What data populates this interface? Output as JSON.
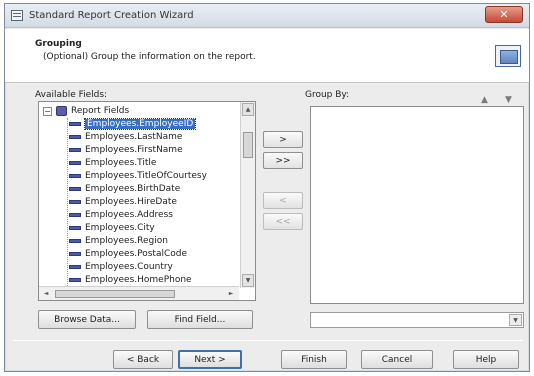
{
  "window": {
    "title": "Standard Report Creation Wizard",
    "close_glyph": "✕"
  },
  "header": {
    "title": "Grouping",
    "description": "(Optional) Group the information on the report.",
    "icon": "group-report-icon"
  },
  "available_fields": {
    "label": "Available Fields:",
    "root": {
      "expander": "−",
      "label": "Report Fields"
    },
    "fields": [
      {
        "name": "Employees.EmployeeID",
        "selected": true
      },
      {
        "name": "Employees.LastName",
        "selected": false
      },
      {
        "name": "Employees.FirstName",
        "selected": false
      },
      {
        "name": "Employees.Title",
        "selected": false
      },
      {
        "name": "Employees.TitleOfCourtesy",
        "selected": false
      },
      {
        "name": "Employees.BirthDate",
        "selected": false
      },
      {
        "name": "Employees.HireDate",
        "selected": false
      },
      {
        "name": "Employees.Address",
        "selected": false
      },
      {
        "name": "Employees.City",
        "selected": false
      },
      {
        "name": "Employees.Region",
        "selected": false
      },
      {
        "name": "Employees.PostalCode",
        "selected": false
      },
      {
        "name": "Employees.Country",
        "selected": false
      },
      {
        "name": "Employees.HomePhone",
        "selected": false
      }
    ]
  },
  "move_buttons": {
    "add": ">",
    "add_all": ">>",
    "remove": "<",
    "remove_all": "<<"
  },
  "group_by": {
    "label": "Group By:",
    "sort_up": "▲",
    "sort_down": "▼"
  },
  "scroll": {
    "up": "▲",
    "down": "▼",
    "left": "◄",
    "right": "►"
  },
  "buttons": {
    "browse_data": "Browse Data...",
    "find_field": "Find Field...",
    "back": "< Back",
    "next": "Next >",
    "finish": "Finish",
    "cancel": "Cancel",
    "help": "Help"
  }
}
